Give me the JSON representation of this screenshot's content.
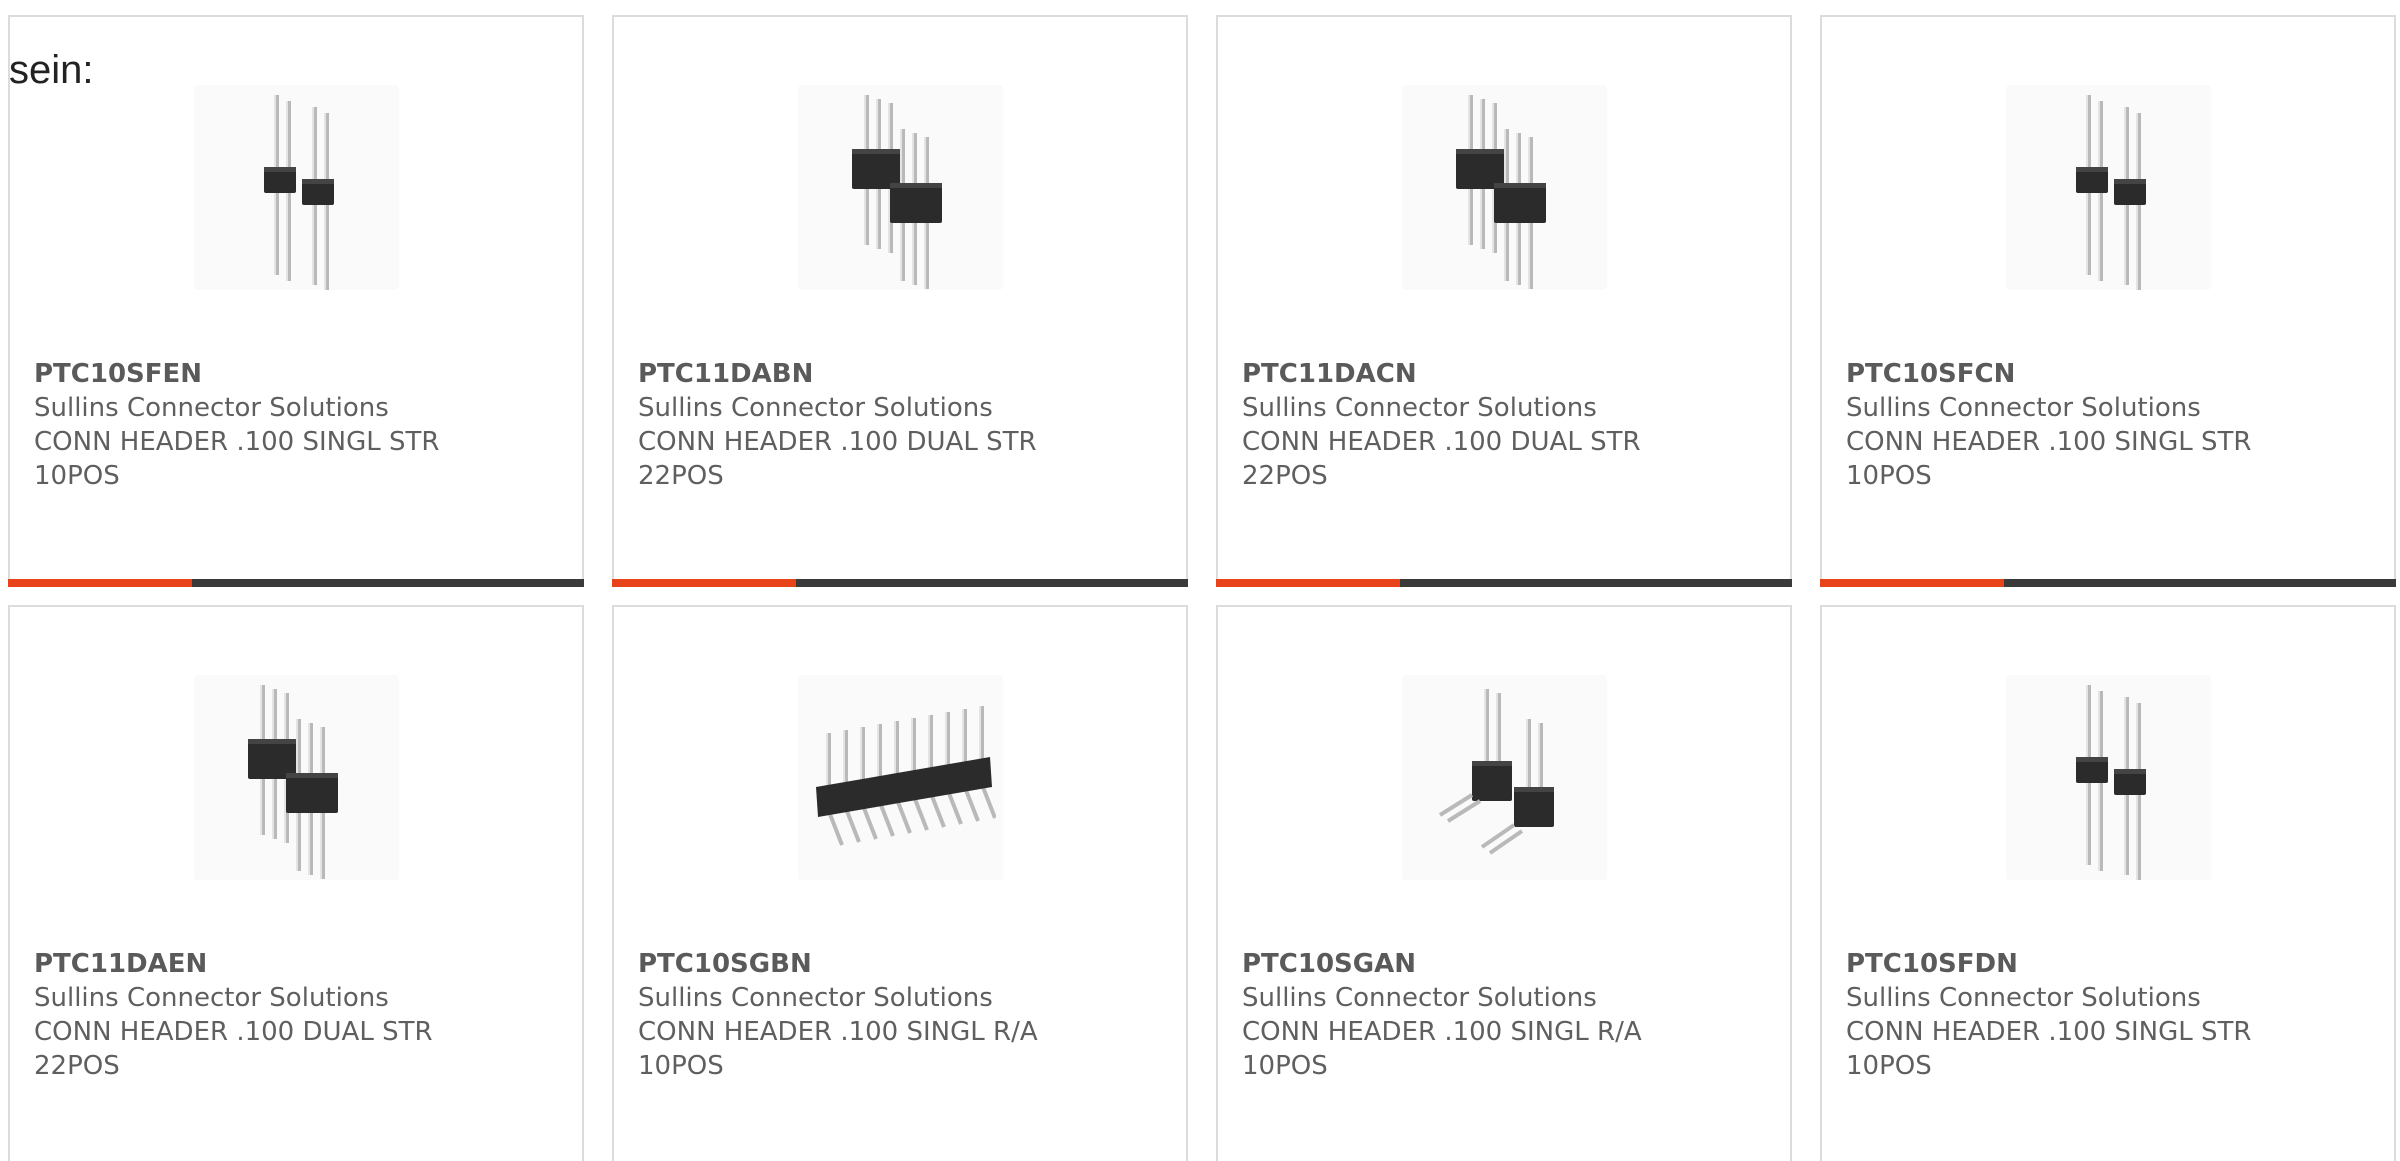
{
  "intro": {
    "text": "sein:"
  },
  "accent_color": "#e8431a",
  "bar_color": "#3a3a3a",
  "cards": [
    {
      "part": "PTC10SFEN",
      "manufacturer": "Sullins Connector Solutions",
      "desc1": "CONN HEADER .100 SINGL STR",
      "desc2": "10POS",
      "image": "single-row-header-icon",
      "progress": 0.32
    },
    {
      "part": "PTC11DABN",
      "manufacturer": "Sullins Connector Solutions",
      "desc1": "CONN HEADER .100 DUAL STR",
      "desc2": "22POS",
      "image": "dual-row-header-icon",
      "progress": 0.32
    },
    {
      "part": "PTC11DACN",
      "manufacturer": "Sullins Connector Solutions",
      "desc1": "CONN HEADER .100 DUAL STR",
      "desc2": "22POS",
      "image": "dual-row-header-icon",
      "progress": 0.32
    },
    {
      "part": "PTC10SFCN",
      "manufacturer": "Sullins Connector Solutions",
      "desc1": "CONN HEADER .100 SINGL STR",
      "desc2": "10POS",
      "image": "single-row-header-icon",
      "progress": 0.32
    },
    {
      "part": "PTC11DAEN",
      "manufacturer": "Sullins Connector Solutions",
      "desc1": "CONN HEADER .100 DUAL STR",
      "desc2": "22POS",
      "image": "dual-row-header-icon"
    },
    {
      "part": "PTC10SGBN",
      "manufacturer": "Sullins Connector Solutions",
      "desc1": "CONN HEADER .100 SINGL R/A",
      "desc2": "10POS",
      "image": "right-angle-header-strip-icon"
    },
    {
      "part": "PTC10SGAN",
      "manufacturer": "Sullins Connector Solutions",
      "desc1": "CONN HEADER .100 SINGL R/A",
      "desc2": "10POS",
      "image": "right-angle-header-icon"
    },
    {
      "part": "PTC10SFDN",
      "manufacturer": "Sullins Connector Solutions",
      "desc1": "CONN HEADER .100 SINGL STR",
      "desc2": "10POS",
      "image": "single-row-header-icon"
    }
  ]
}
